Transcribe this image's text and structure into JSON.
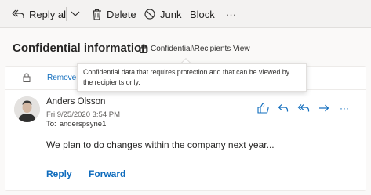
{
  "toolbar": {
    "reply_all_label": "Reply all",
    "delete_label": "Delete",
    "junk_label": "Junk",
    "block_label": "Block",
    "more_label": "···"
  },
  "message": {
    "subject": "Confidential information",
    "sensitivity_label": "Confidential\\Recipients View",
    "banner_remove": "Remove",
    "sender_name": "Anders Olsson",
    "date": "Fri 9/25/2020 3:54 PM",
    "to_label": "To:",
    "to_value": "anderspsyne1",
    "body": "We plan to do changes within the company next year...",
    "more_label": "···"
  },
  "tooltip": {
    "text": "Confidential data that requires protection and that can be viewed by the recipients only."
  },
  "footer": {
    "reply_label": "Reply",
    "forward_label": "Forward"
  },
  "colors": {
    "accent": "#0f6cbd",
    "toolbar_bg": "#f3f2f1"
  }
}
